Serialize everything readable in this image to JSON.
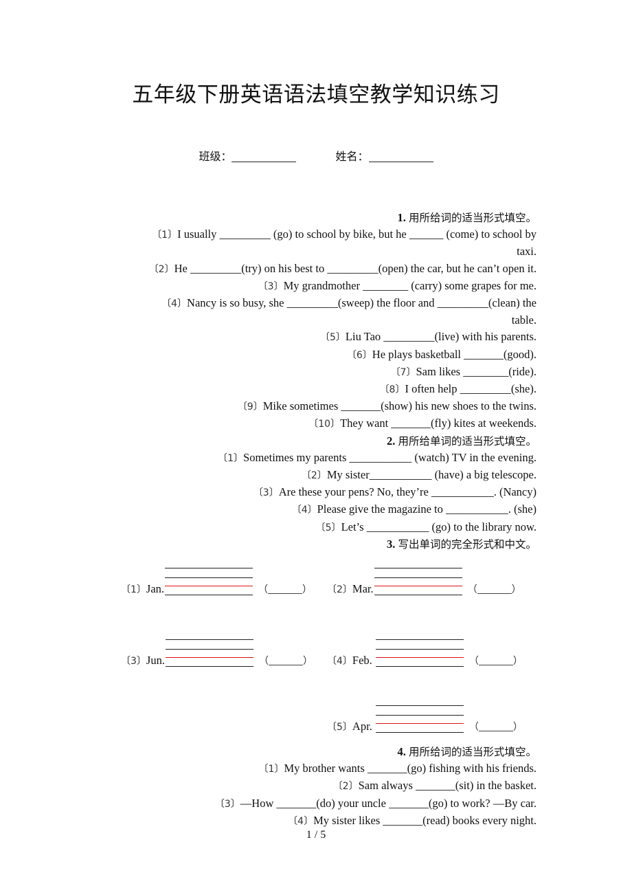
{
  "title": "五年级下册英语语法填空教学知识练习",
  "info": {
    "class_label": "班级：",
    "name_label": "姓名："
  },
  "section1": {
    "number": "1.",
    "instruction": "用所给词的适当形式填空。",
    "items": [
      {
        "index": "〔1〕",
        "text": "I usually _________ (go) to school by bike, but he ______ (come) to school by",
        "cont": "taxi."
      },
      {
        "index": "〔2〕",
        "text": "He _________(try) on his best to _________(open) the car, but he can’t open it."
      },
      {
        "index": "〔3〕",
        "text": "My grandmother ________ (carry) some grapes for me."
      },
      {
        "index": "〔4〕",
        "text": "Nancy is so busy, she _________(sweep) the floor and _________(clean) the",
        "cont": "table."
      },
      {
        "index": "〔5〕",
        "text": "Liu Tao _________(live) with his parents."
      },
      {
        "index": "〔6〕",
        "text": "He plays basketball _______(good)."
      },
      {
        "index": "〔7〕",
        "text": "Sam likes ________(ride)."
      },
      {
        "index": "〔8〕",
        "text": "I often help _________(she)."
      },
      {
        "index": "〔9〕",
        "text": "Mike sometimes _______(show) his new shoes to the twins."
      },
      {
        "index": "〔10〕",
        "text": "They want _______(fly) kites at weekends."
      }
    ]
  },
  "section2": {
    "number": "2.",
    "instruction": "用所给单词的适当形式填空。",
    "items": [
      {
        "index": "〔1〕",
        "text": "Sometimes my parents ___________ (watch) TV in the evening."
      },
      {
        "index": "〔2〕",
        "text": "My sister___________ (have) a big telescope."
      },
      {
        "index": "〔3〕",
        "text": "Are these your pens? No, they’re ___________. (Nancy)"
      },
      {
        "index": "〔4〕",
        "text": "Please give the magazine to ___________. (she)"
      },
      {
        "index": "〔5〕",
        "text": "Let’s ___________ (go) to the library now."
      }
    ]
  },
  "section3": {
    "number": "3.",
    "instruction": "写出单词的完全形式和中文。",
    "items": [
      {
        "index": "〔1〕",
        "word": "Jan."
      },
      {
        "index": "〔2〕",
        "word": "Mar."
      },
      {
        "index": "〔3〕",
        "word": "Jun."
      },
      {
        "index": "〔4〕",
        "word": "Feb."
      },
      {
        "index": "〔5〕",
        "word": "Apr."
      }
    ],
    "paren_open": "（",
    "paren_close": "）",
    "colors": {
      "guide_line": "#222222",
      "baseline_red": "#e01010"
    }
  },
  "section4": {
    "number": "4.",
    "instruction": "用所给词的适当形式填空。",
    "items": [
      {
        "index": "〔1〕",
        "text": "My brother wants _______(go) fishing with his friends."
      },
      {
        "index": "〔2〕",
        "text": "Sam always _______(sit) in the basket."
      },
      {
        "index": "〔3〕",
        "text": "—How _______(do) your uncle _______(go) to work? —By car."
      },
      {
        "index": "〔4〕",
        "text": "My sister likes _______(read) books every night."
      }
    ]
  },
  "footer": {
    "page": "1 / 5"
  }
}
